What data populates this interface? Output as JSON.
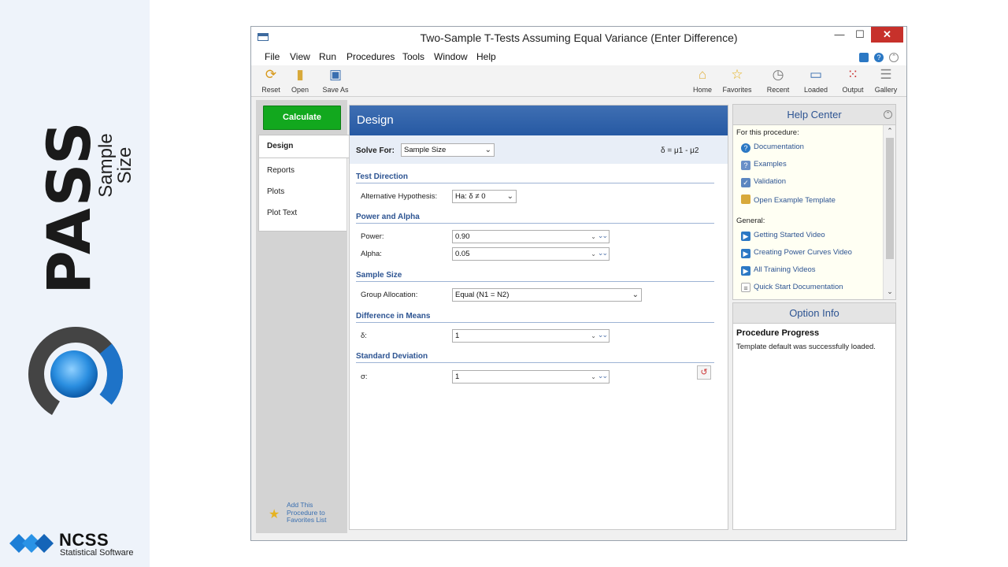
{
  "brand": {
    "product": "PASS",
    "tagline": "Sample Size",
    "company": "NCSS",
    "company_sub": "Statistical Software"
  },
  "window": {
    "title": "Two-Sample T-Tests Assuming Equal Variance (Enter Difference)",
    "min": "—",
    "max": "☐",
    "close": "✕"
  },
  "menu": [
    "File",
    "View",
    "Run",
    "Procedures",
    "Tools",
    "Window",
    "Help"
  ],
  "toolbar": {
    "reset": "Reset",
    "open": "Open",
    "save_as": "Save As",
    "home": "Home",
    "favorites": "Favorites",
    "recent": "Recent",
    "loaded": "Loaded",
    "output": "Output",
    "gallery": "Gallery"
  },
  "left_nav": {
    "calculate": "Calculate",
    "design": "Design",
    "reports": "Reports",
    "plots": "Plots",
    "plot_text": "Plot Text",
    "favorites_add": "Add This\nProcedure to\nFavorites List"
  },
  "design": {
    "header": "Design",
    "solve_for_label": "Solve For:",
    "solve_for_value": "Sample Size",
    "formula": "δ = μ1 - μ2",
    "sections": {
      "test_direction": "Test Direction",
      "power_alpha": "Power and Alpha",
      "sample_size": "Sample Size",
      "difference_means": "Difference in Means",
      "std_dev": "Standard Deviation"
    },
    "fields": {
      "alt_hyp_label": "Alternative Hypothesis:",
      "alt_hyp_value": "Ha: δ ≠ 0",
      "power_label": "Power:",
      "power_value": "0.90",
      "alpha_label": "Alpha:",
      "alpha_value": "0.05",
      "group_alloc_label": "Group Allocation:",
      "group_alloc_value": "Equal (N1 = N2)",
      "delta_label": "δ:",
      "delta_value": "1",
      "sigma_label": "σ:",
      "sigma_value": "1"
    }
  },
  "help_center": {
    "title": "Help Center",
    "for_this": "For this procedure:",
    "documentation": "Documentation",
    "examples": "Examples",
    "validation": "Validation",
    "open_template": "Open Example Template",
    "general": "General:",
    "getting_started": "Getting Started Video",
    "power_curves": "Creating Power Curves Video",
    "all_training": "All Training Videos",
    "quick_start": "Quick Start Documentation"
  },
  "option_info": {
    "title": "Option Info",
    "progress_title": "Procedure Progress",
    "progress_msg": "Template default was successfully loaded."
  },
  "colors": {
    "calculate": "#12a81e",
    "design_header": "#2d5ea7",
    "section_text": "#2d5492",
    "close_button": "#c7312b"
  }
}
